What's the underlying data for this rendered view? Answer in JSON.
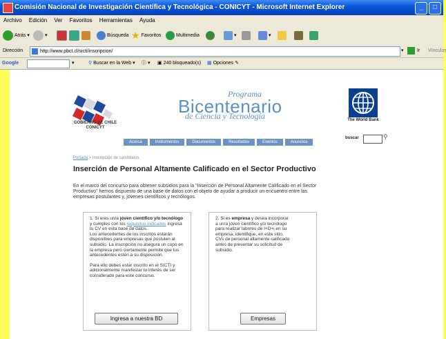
{
  "window": {
    "title": "Comisión Nacional de Investigación Científica y Tecnológica - CONICYT - Microsoft Internet Explorer"
  },
  "menubar": [
    "Archivo",
    "Edición",
    "Ver",
    "Favoritos",
    "Herramientas",
    "Ayuda"
  ],
  "toolbar": {
    "back_label": "Atrás",
    "search_label": "Búsqueda",
    "favorites_label": "Favoritos",
    "multimedia_label": "Multimedia"
  },
  "address": {
    "label": "Dirección",
    "url": "http://www.pbct.cl/sicti/inscripcion/",
    "go_label": "Ir",
    "links_label": "Vínculos"
  },
  "googlebar": {
    "logo": "Google",
    "web_search_label": "Buscar en la Web",
    "blocked_label": "240 bloqueado(s)",
    "options_label": "Opciones"
  },
  "header": {
    "chile_caption_1": "GOBIERNO DE CHILE",
    "chile_caption_2": "CONICYT",
    "prog_line1": "Programa",
    "prog_line2": "Bicentenario",
    "prog_line3": "de Ciencia y Tecnología",
    "wb_caption": "The World Bank"
  },
  "nav": [
    "Acerca",
    "Instrumentos",
    "Documentos",
    "Resultados",
    "Eventos",
    "Anuncios"
  ],
  "search": {
    "label": "buscar"
  },
  "breadcrumb": {
    "home": "Portada",
    "sep": " > ",
    "current": "Inscripción de candidatos"
  },
  "page": {
    "title": "Inserción de Personal Altamente Calificado en el Sector Productivo",
    "intro": "En el marco del concurso para obtener subsidios para la \"Inserción de Personal Altamente Calificado en el Sector Productivo\" hemos dispuesto de una base de datos con el objeto de ayudar a producir un encuentro entre las empresas postulantes y, jóvenes científicos y tecnólogos."
  },
  "panel_left": {
    "p1_a": "1. Si eres un/a ",
    "p1_b": "jóven científico y/o tecnólogo",
    "p1_c": " y cumples con los ",
    "p1_link": "requisitos indicados",
    "p1_d": " ingresa tu CV en esta base de datos.",
    "p2": "Los antecedentes de los inscritos estarán disponibles para empresas que postulen al subsidio. La inscripción no asegura un cupo en la empresa pero ciertamente permite que tus antecedentes estén a su disposición.",
    "p3": "Para ello debes estar inscrito en el SICTI y adicionalmente manifestar tu interés de ser considerado para este concurso.",
    "button": "Ingresa a nuestra BD"
  },
  "panel_right": {
    "p1_a": "2. Si es ",
    "p1_b": "empresa",
    "p1_c": " y desea incorporar a un/a jóven científico y/o tecnólogo para realizar labores de I+D+i en su empresa, identifique, en este sitio, CVs de personal altamente calificado antes de presentar su solicitud de subsidio.",
    "button": "Empresas"
  }
}
